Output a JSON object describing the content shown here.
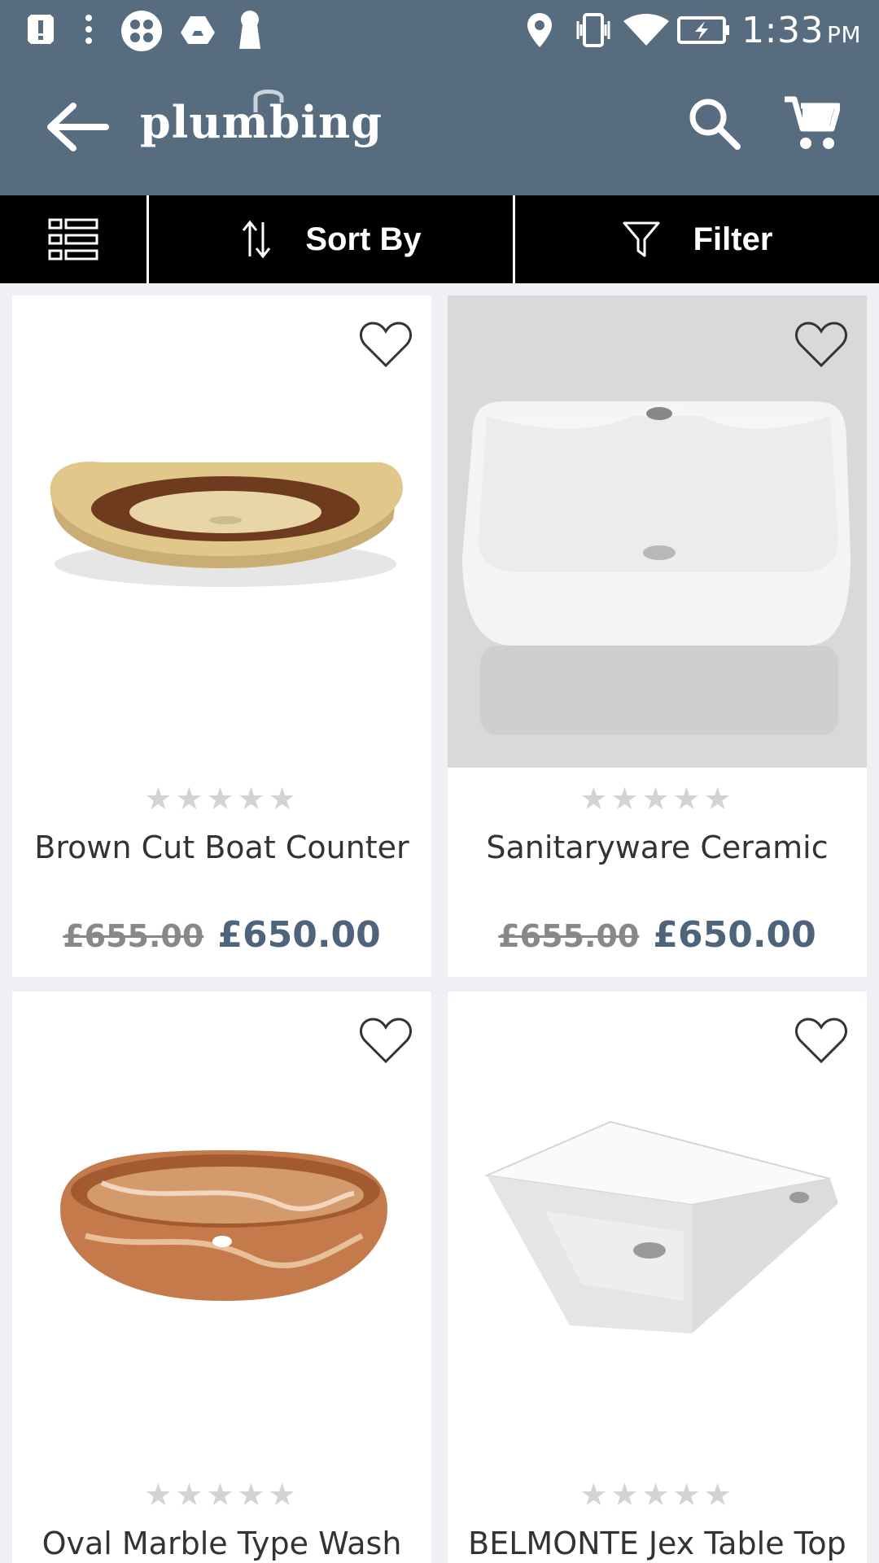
{
  "status_bar": {
    "time": "1:33",
    "ampm": "PM"
  },
  "header": {
    "logo_text": "plumbing",
    "back_icon": "arrow-back-icon",
    "search_icon": "search-icon",
    "cart_icon": "cart-icon"
  },
  "toolbar": {
    "view_icon": "list-view-icon",
    "sort_label": "Sort By",
    "filter_label": "Filter"
  },
  "colors": {
    "app_bar": "#576c7f",
    "price": "#4d647a",
    "toolbar": "#000000"
  },
  "products": [
    {
      "name": "Brown Cut Boat Counter",
      "old_price": "£655.00",
      "price": "£650.00"
    },
    {
      "name": "Sanitaryware Ceramic",
      "old_price": "£655.00",
      "price": "£650.00"
    },
    {
      "name": "Oval Marble Type Wash",
      "old_price": "",
      "price": ""
    },
    {
      "name": "BELMONTE Jex Table Top",
      "old_price": "",
      "price": ""
    }
  ]
}
